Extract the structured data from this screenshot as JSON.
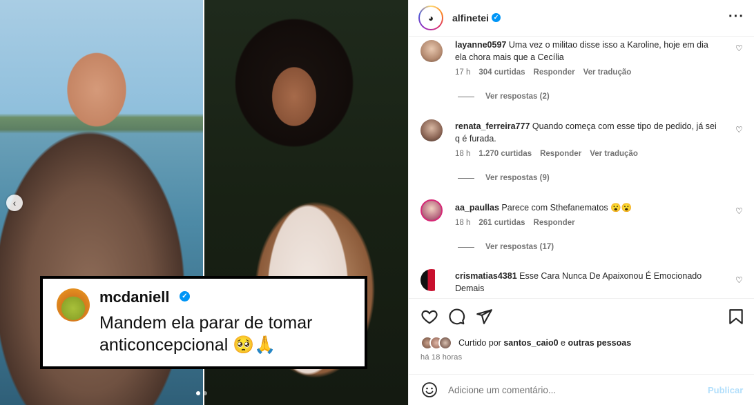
{
  "post": {
    "author": "alfinetei",
    "more_icon": "more-horizontal-icon",
    "verified_icon": "verified-badge-icon"
  },
  "media": {
    "overlay": {
      "username": "mcdaniell",
      "text": "Mandem ela parar de tomar anticoncepcional 🥺🙏"
    },
    "carousel_prev_icon": "chevron-left-icon",
    "carousel_dots": 2,
    "carousel_active_index": 1
  },
  "comments": [
    {
      "username": "layanne0597",
      "text": "Uma vez o militao disse isso a Karoline, hoje em dia ela chora mais que a Cecília",
      "time": "17 h",
      "likes": "304 curtidas",
      "reply": "Responder",
      "translate": "Ver tradução",
      "replies": "Ver respostas (2)"
    },
    {
      "username": "renata_ferreira777",
      "text": "Quando começa com esse tipo de pedido, já sei q é furada.",
      "time": "18 h",
      "likes": "1.270 curtidas",
      "reply": "Responder",
      "translate": "Ver tradução",
      "replies": "Ver respostas (9)"
    },
    {
      "username": "aa_paullas",
      "text": "Parece com Sthefanematos 😮😮",
      "time": "18 h",
      "likes": "261 curtidas",
      "reply": "Responder",
      "replies": "Ver respostas (17)"
    },
    {
      "username": "crismatias4381",
      "text": "Esse Cara Nunca De Apaixonou É Emocionado Demais"
    }
  ],
  "actions": {
    "like_icon": "heart-icon",
    "comment_icon": "comment-icon",
    "share_icon": "send-icon",
    "save_icon": "bookmark-icon"
  },
  "likes_summary": {
    "prefix": "Curtido por",
    "user": "santos_caio0",
    "connector": "e",
    "others": "outras pessoas"
  },
  "time_ago": "há 18 horas",
  "add_comment": {
    "placeholder": "Adicione um comentário...",
    "publish": "Publicar",
    "emoji_icon": "emoji-icon"
  },
  "colors": {
    "accent": "#0095f6",
    "publish_disabled": "#b2dffc",
    "secondary_text": "#737373"
  }
}
